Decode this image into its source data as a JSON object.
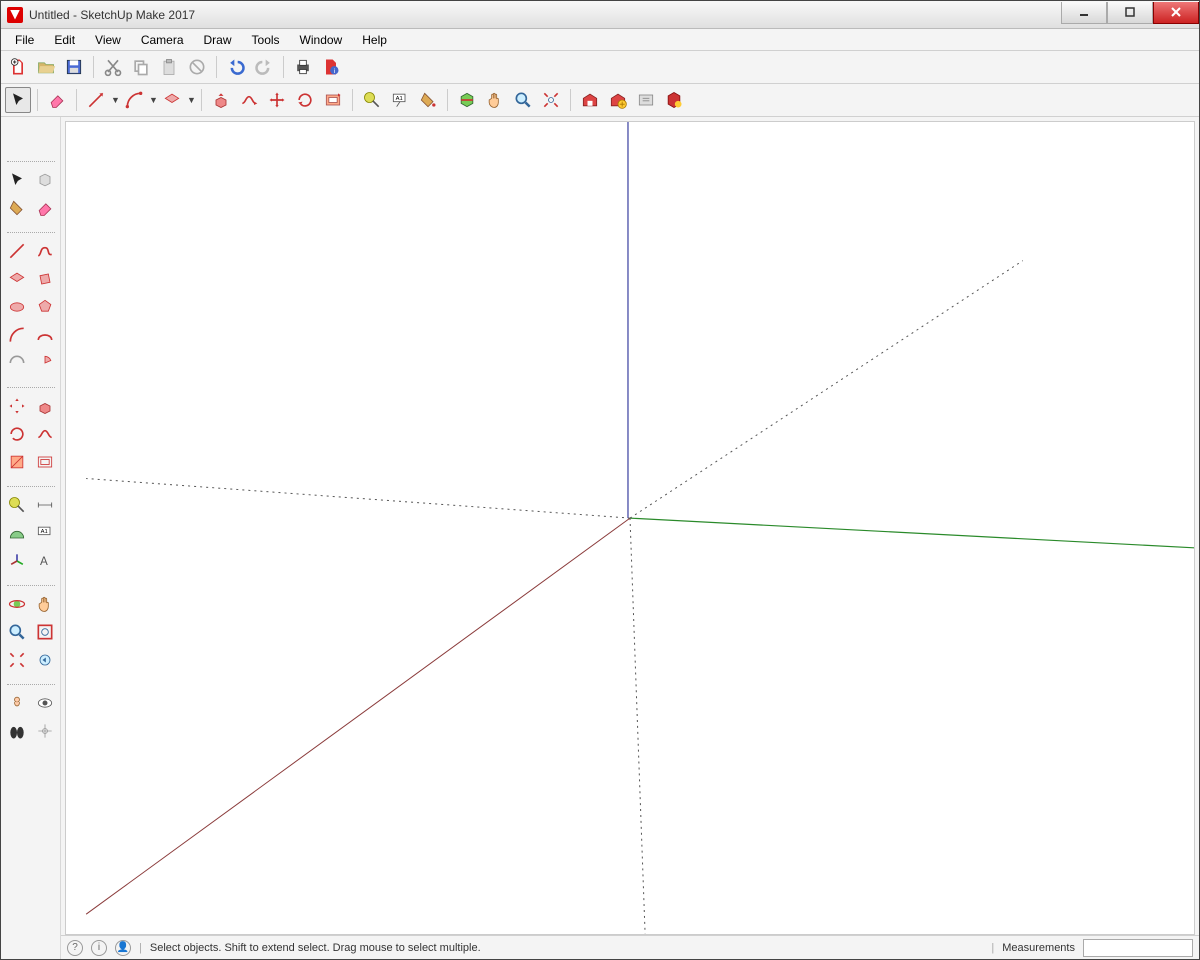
{
  "window": {
    "title": "Untitled - SketchUp Make 2017"
  },
  "menu": [
    "File",
    "Edit",
    "View",
    "Camera",
    "Draw",
    "Tools",
    "Window",
    "Help"
  ],
  "statusbar": {
    "hint": "Select objects. Shift to extend select. Drag mouse to select multiple.",
    "measurements_label": "Measurements",
    "measurements_value": ""
  },
  "toolbar1_icons": [
    "new-file",
    "open-file",
    "save-file",
    "cut",
    "copy",
    "paste",
    "delete",
    "undo",
    "redo",
    "print",
    "model-info"
  ],
  "toolbar2_icons": [
    "select",
    "eraser",
    "line",
    "arc",
    "rectangle",
    "push-pull",
    "follow-me",
    "move",
    "rotate",
    "offset",
    "tape-measure",
    "text",
    "paint-bucket",
    "section-plane",
    "pan",
    "zoom",
    "zoom-extents",
    "3d-warehouse",
    "add-location",
    "share",
    "warehouse-upload",
    "ruby"
  ],
  "side_tool_icons": [
    "select",
    "make-component",
    "paint-bucket",
    "eraser",
    "line",
    "freehand",
    "rectangle",
    "rotated-rect",
    "circle",
    "polygon",
    "arc",
    "2pt-arc",
    "3pt-arc",
    "pie",
    "move",
    "push-pull",
    "rotate",
    "follow-me",
    "scale",
    "offset",
    "tape-measure",
    "dimension",
    "protractor",
    "text-label",
    "axes",
    "3d-text",
    "section",
    "pan",
    "zoom",
    "zoom-window",
    "zoom-extents",
    "orbit",
    "position-camera",
    "look-around",
    "walk",
    "previous-view"
  ],
  "colors": {
    "axis_red": "#a03030",
    "axis_green": "#2a8a2a",
    "axis_blue": "#3a40a0",
    "dotted": "#888"
  }
}
